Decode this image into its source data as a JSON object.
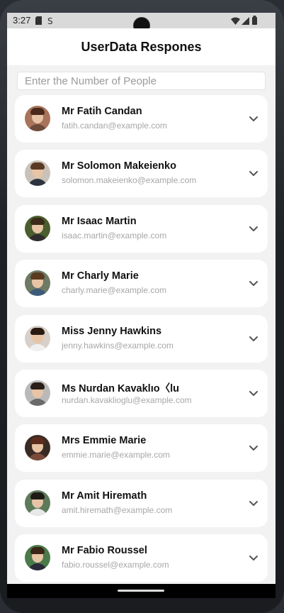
{
  "status_bar": {
    "time": "3:27",
    "icons": [
      "sim-card-icon",
      "data-saver-icon",
      "wifi-icon",
      "signal-icon",
      "battery-icon"
    ]
  },
  "app_bar": {
    "title": "UserData Respones"
  },
  "search": {
    "placeholder": "Enter the Number of People",
    "value": ""
  },
  "users": [
    {
      "name": "Mr Fatih Candan",
      "email": "fatih.candan@example.com",
      "avatar_colors": {
        "bg": "#a8745c",
        "hair": "#4a2a1c",
        "shirt": "#6d4b3b"
      }
    },
    {
      "name": "Mr Solomon Makeienko",
      "email": "solomon.makeienko@example.com",
      "avatar_colors": {
        "bg": "#c9c2b8",
        "hair": "#5a3a24",
        "shirt": "#2d3440"
      }
    },
    {
      "name": "Mr Isaac Martin",
      "email": "isaac.martin@example.com",
      "avatar_colors": {
        "bg": "#4a5e2e",
        "hair": "#3b2a1a",
        "shirt": "#2e2e2e"
      }
    },
    {
      "name": "Mr Charly Marie",
      "email": "charly.marie@example.com",
      "avatar_colors": {
        "bg": "#6d7a64",
        "hair": "#5b3b20",
        "shirt": "#3d5a7a"
      }
    },
    {
      "name": "Miss Jenny Hawkins",
      "email": "jenny.hawkins@example.com",
      "avatar_colors": {
        "bg": "#d8d0c8",
        "hair": "#2a1a12",
        "shirt": "#f0f0f0"
      }
    },
    {
      "name": "Ms Nurdan Kavaklıo〈lu",
      "email": "nurdan.kavaklioglu@example.com",
      "avatar_colors": {
        "bg": "#b9b9b9",
        "hair": "#2a1e18",
        "shirt": "#6a6a6a"
      }
    },
    {
      "name": "Mrs Emmie Marie",
      "email": "emmie.marie@example.com",
      "avatar_colors": {
        "bg": "#3a2a24",
        "hair": "#5c2c1c",
        "shirt": "#7a4a3a"
      }
    },
    {
      "name": "Mr Amit Hiremath",
      "email": "amit.hiremath@example.com",
      "avatar_colors": {
        "bg": "#5d7a5a",
        "hair": "#1e1a16",
        "shirt": "#e8e8e8"
      }
    },
    {
      "name": "Mr Fabio Roussel",
      "email": "fabio.roussel@example.com",
      "avatar_colors": {
        "bg": "#4a7a4a",
        "hair": "#3a2616",
        "shirt": "#2a2a3a"
      }
    }
  ]
}
